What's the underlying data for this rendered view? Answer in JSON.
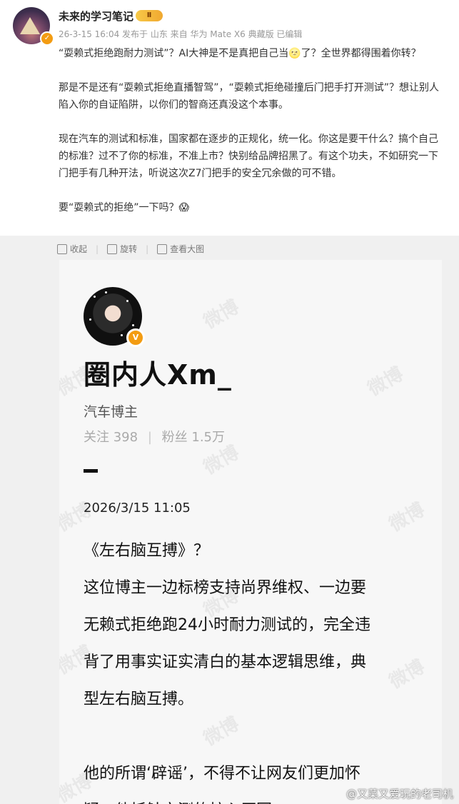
{
  "post": {
    "username": "未来的学习笔记",
    "vip_label": "Ⅱ",
    "meta": "26-3-15 16:04 发布于 山东 来自 华为 Mate X6 典藏版 已编辑",
    "paragraphs": [
      "“耍赖式拒绝跑耐力测试”？AI大神是不是真把自己当🌝了？全世界都得围着你转？",
      "那是不是还有“耍赖式拒绝直播智驾”，“耍赖式拒绝碰撞后门把手打开测试”？想让别人陷入你的自证陷阱，以你们的智商还真没这个本事。",
      "现在汽车的测试和标准，国家都在逐步的正规化，统一化。你这是要干什么？搞个自己的标准？过不了你的标准，不准上市？快别给品牌招黑了。有这个功夫，不如研究一下门把手有几种开法，听说这次Z7门把手的安全冗余做的可不错。",
      "要“耍赖式的拒绝”一下吗？😱"
    ]
  },
  "image_toolbar": {
    "collect": "收起",
    "rotate": "旋转",
    "view_large": "查看大图"
  },
  "card": {
    "name": "圈内人Xm_",
    "role": "汽车博主",
    "follow_label": "关注",
    "follow_count": "398",
    "fans_label": "粉丝",
    "fans_count": "1.5万",
    "time": "2026/3/15 11:05",
    "lines_a": [
      "《左右脑互搏》？",
      "这位博主一边标榜支持尚界维权、一边要",
      "无赖式拒绝跑24小时耐力测试的，完全违",
      "背了用事实证实清白的基本逻辑思维，典",
      "型左右脑互搏。"
    ],
    "lines_b": [
      "他的所谓‘辟谣’，不得不让网友们更加怀",
      "疑，他抵触实测的核心原因："
    ],
    "watermark": "微博"
  },
  "footer_watermark": "@又菜又爱玩的老司机"
}
